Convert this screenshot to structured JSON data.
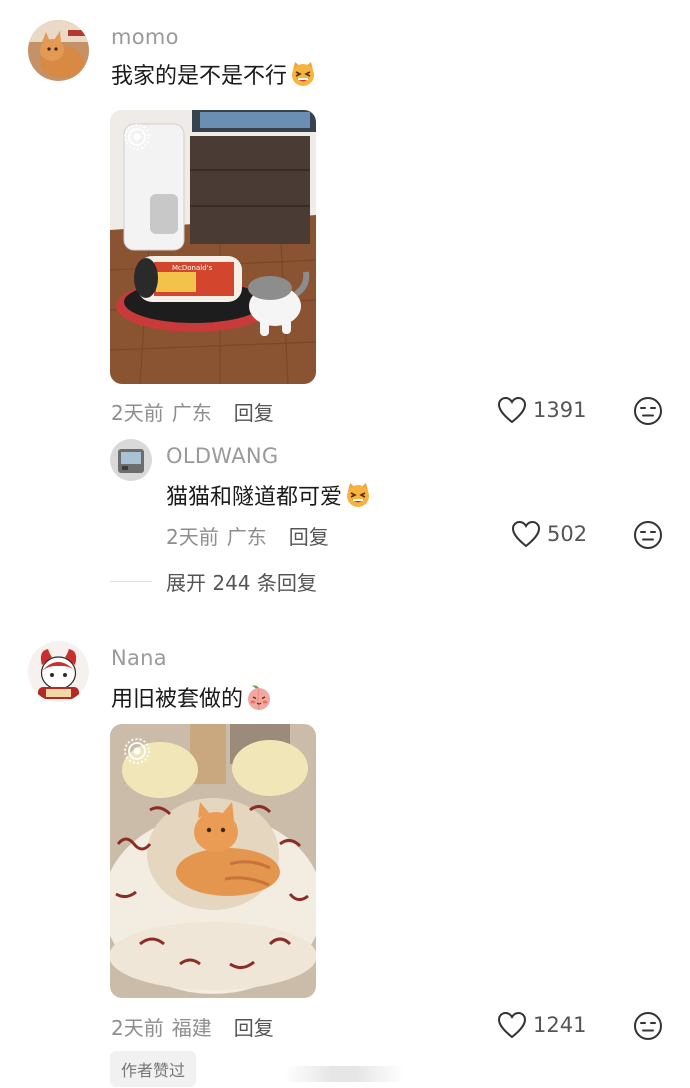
{
  "comments": [
    {
      "username": "momo",
      "text": "我家的是不是不行",
      "emoji": "grinning-cat-squint-emoji",
      "time": "2天前",
      "location": "广东",
      "reply_label": "回复",
      "likes": "1391"
    },
    {
      "username": "Nana",
      "text": "用旧被套做的",
      "emoji": "peach-blush-emoji",
      "time": "2天前",
      "location": "福建",
      "reply_label": "回复",
      "likes": "1241",
      "author_liked_badge": "作者赞过"
    }
  ],
  "reply": {
    "username": "OLDWANG",
    "text": "猫猫和隧道都可爱",
    "emoji": "grinning-cat-squint-emoji",
    "time": "2天前",
    "location": "广东",
    "reply_label": "回复",
    "likes": "502"
  },
  "expand_replies": "展开 244 条回复",
  "photo1_text": "McDonald's",
  "icons": {
    "like": "heart-outline-icon",
    "react": "neutral-face-icon",
    "live": "live-photo-icon"
  },
  "colors": {
    "username": "#9a9a9a",
    "meta": "#8e8e8e",
    "text": "#1a1a1a"
  }
}
